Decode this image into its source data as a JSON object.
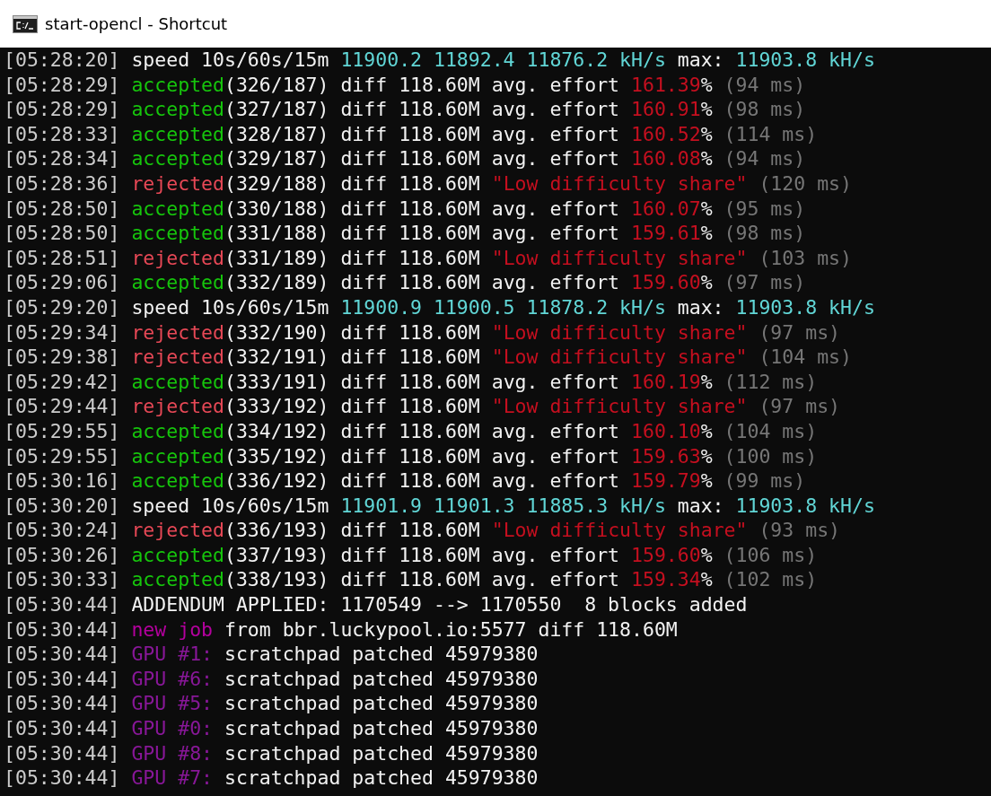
{
  "window": {
    "title": "start-opencl - Shortcut"
  },
  "lines": [
    [
      {
        "kind": "time",
        "text": "[05:28:20]"
      },
      {
        "kind": "text",
        "text": "speed 10s/60s/15m "
      },
      {
        "kind": "rate",
        "text": "11900.2 11892.4 11876.2 kH/s"
      },
      {
        "kind": "text",
        "text": " max: "
      },
      {
        "kind": "rate",
        "text": "11903.8 kH/s"
      }
    ],
    [
      {
        "kind": "time",
        "text": "[05:28:29]"
      },
      {
        "kind": "ok",
        "text": "accepted"
      },
      {
        "kind": "text",
        "text": "(326/187) diff 118.60M avg. effort "
      },
      {
        "kind": "pct",
        "text": "161.39"
      },
      {
        "kind": "text",
        "text": "%"
      },
      {
        "kind": "dim",
        "text": "(94 ms)"
      }
    ],
    [
      {
        "kind": "time",
        "text": "[05:28:29]"
      },
      {
        "kind": "ok",
        "text": "accepted"
      },
      {
        "kind": "text",
        "text": "(327/187) diff 118.60M avg. effort "
      },
      {
        "kind": "pct",
        "text": "160.91"
      },
      {
        "kind": "text",
        "text": "%"
      },
      {
        "kind": "dim",
        "text": "(98 ms)"
      }
    ],
    [
      {
        "kind": "time",
        "text": "[05:28:33]"
      },
      {
        "kind": "ok",
        "text": "accepted"
      },
      {
        "kind": "text",
        "text": "(328/187) diff 118.60M avg. effort "
      },
      {
        "kind": "pct",
        "text": "160.52"
      },
      {
        "kind": "text",
        "text": "%"
      },
      {
        "kind": "dim",
        "text": "(114 ms)"
      }
    ],
    [
      {
        "kind": "time",
        "text": "[05:28:34]"
      },
      {
        "kind": "ok",
        "text": "accepted"
      },
      {
        "kind": "text",
        "text": "(329/187) diff 118.60M avg. effort "
      },
      {
        "kind": "pct",
        "text": "160.08"
      },
      {
        "kind": "text",
        "text": "%"
      },
      {
        "kind": "dim",
        "text": "(94 ms)"
      }
    ],
    [
      {
        "kind": "time",
        "text": "[05:28:36]"
      },
      {
        "kind": "bad",
        "text": "rejected"
      },
      {
        "kind": "text",
        "text": "(329/188) diff 118.60M "
      },
      {
        "kind": "pct",
        "text": "\"Low difficulty share\""
      },
      {
        "kind": "dim",
        "text": "(120 ms)"
      }
    ],
    [
      {
        "kind": "time",
        "text": "[05:28:50]"
      },
      {
        "kind": "ok",
        "text": "accepted"
      },
      {
        "kind": "text",
        "text": "(330/188) diff 118.60M avg. effort "
      },
      {
        "kind": "pct",
        "text": "160.07"
      },
      {
        "kind": "text",
        "text": "%"
      },
      {
        "kind": "dim",
        "text": "(95 ms)"
      }
    ],
    [
      {
        "kind": "time",
        "text": "[05:28:50]"
      },
      {
        "kind": "ok",
        "text": "accepted"
      },
      {
        "kind": "text",
        "text": "(331/188) diff 118.60M avg. effort "
      },
      {
        "kind": "pct",
        "text": "159.61"
      },
      {
        "kind": "text",
        "text": "%"
      },
      {
        "kind": "dim",
        "text": "(98 ms)"
      }
    ],
    [
      {
        "kind": "time",
        "text": "[05:28:51]"
      },
      {
        "kind": "bad",
        "text": "rejected"
      },
      {
        "kind": "text",
        "text": "(331/189) diff 118.60M "
      },
      {
        "kind": "pct",
        "text": "\"Low difficulty share\""
      },
      {
        "kind": "dim",
        "text": "(103 ms)"
      }
    ],
    [
      {
        "kind": "time",
        "text": "[05:29:06]"
      },
      {
        "kind": "ok",
        "text": "accepted"
      },
      {
        "kind": "text",
        "text": "(332/189) diff 118.60M avg. effort "
      },
      {
        "kind": "pct",
        "text": "159.60"
      },
      {
        "kind": "text",
        "text": "%"
      },
      {
        "kind": "dim",
        "text": "(97 ms)"
      }
    ],
    [
      {
        "kind": "time",
        "text": "[05:29:20]"
      },
      {
        "kind": "text",
        "text": "speed 10s/60s/15m "
      },
      {
        "kind": "rate",
        "text": "11900.9 11900.5 11878.2 kH/s"
      },
      {
        "kind": "text",
        "text": " max: "
      },
      {
        "kind": "rate",
        "text": "11903.8 kH/s"
      }
    ],
    [
      {
        "kind": "time",
        "text": "[05:29:34]"
      },
      {
        "kind": "bad",
        "text": "rejected"
      },
      {
        "kind": "text",
        "text": "(332/190) diff 118.60M "
      },
      {
        "kind": "pct",
        "text": "\"Low difficulty share\""
      },
      {
        "kind": "dim",
        "text": "(97 ms)"
      }
    ],
    [
      {
        "kind": "time",
        "text": "[05:29:38]"
      },
      {
        "kind": "bad",
        "text": "rejected"
      },
      {
        "kind": "text",
        "text": "(332/191) diff 118.60M "
      },
      {
        "kind": "pct",
        "text": "\"Low difficulty share\""
      },
      {
        "kind": "dim",
        "text": "(104 ms)"
      }
    ],
    [
      {
        "kind": "time",
        "text": "[05:29:42]"
      },
      {
        "kind": "ok",
        "text": "accepted"
      },
      {
        "kind": "text",
        "text": "(333/191) diff 118.60M avg. effort "
      },
      {
        "kind": "pct",
        "text": "160.19"
      },
      {
        "kind": "text",
        "text": "%"
      },
      {
        "kind": "dim",
        "text": "(112 ms)"
      }
    ],
    [
      {
        "kind": "time",
        "text": "[05:29:44]"
      },
      {
        "kind": "bad",
        "text": "rejected"
      },
      {
        "kind": "text",
        "text": "(333/192) diff 118.60M "
      },
      {
        "kind": "pct",
        "text": "\"Low difficulty share\""
      },
      {
        "kind": "dim",
        "text": "(97 ms)"
      }
    ],
    [
      {
        "kind": "time",
        "text": "[05:29:55]"
      },
      {
        "kind": "ok",
        "text": "accepted"
      },
      {
        "kind": "text",
        "text": "(334/192) diff 118.60M avg. effort "
      },
      {
        "kind": "pct",
        "text": "160.10"
      },
      {
        "kind": "text",
        "text": "%"
      },
      {
        "kind": "dim",
        "text": "(104 ms)"
      }
    ],
    [
      {
        "kind": "time",
        "text": "[05:29:55]"
      },
      {
        "kind": "ok",
        "text": "accepted"
      },
      {
        "kind": "text",
        "text": "(335/192) diff 118.60M avg. effort "
      },
      {
        "kind": "pct",
        "text": "159.63"
      },
      {
        "kind": "text",
        "text": "%"
      },
      {
        "kind": "dim",
        "text": "(100 ms)"
      }
    ],
    [
      {
        "kind": "time",
        "text": "[05:30:16]"
      },
      {
        "kind": "ok",
        "text": "accepted"
      },
      {
        "kind": "text",
        "text": "(336/192) diff 118.60M avg. effort "
      },
      {
        "kind": "pct",
        "text": "159.79"
      },
      {
        "kind": "text",
        "text": "%"
      },
      {
        "kind": "dim",
        "text": "(99 ms)"
      }
    ],
    [
      {
        "kind": "time",
        "text": "[05:30:20]"
      },
      {
        "kind": "text",
        "text": "speed 10s/60s/15m "
      },
      {
        "kind": "rate",
        "text": "11901.9 11901.3 11885.3 kH/s"
      },
      {
        "kind": "text",
        "text": " max: "
      },
      {
        "kind": "rate",
        "text": "11903.8 kH/s"
      }
    ],
    [
      {
        "kind": "time",
        "text": "[05:30:24]"
      },
      {
        "kind": "bad",
        "text": "rejected"
      },
      {
        "kind": "text",
        "text": "(336/193) diff 118.60M "
      },
      {
        "kind": "pct",
        "text": "\"Low difficulty share\""
      },
      {
        "kind": "dim",
        "text": "(93 ms)"
      }
    ],
    [
      {
        "kind": "time",
        "text": "[05:30:26]"
      },
      {
        "kind": "ok",
        "text": "accepted"
      },
      {
        "kind": "text",
        "text": "(337/193) diff 118.60M avg. effort "
      },
      {
        "kind": "pct",
        "text": "159.60"
      },
      {
        "kind": "text",
        "text": "%"
      },
      {
        "kind": "dim",
        "text": "(106 ms)"
      }
    ],
    [
      {
        "kind": "time",
        "text": "[05:30:33]"
      },
      {
        "kind": "ok",
        "text": "accepted"
      },
      {
        "kind": "text",
        "text": "(338/193) diff 118.60M avg. effort "
      },
      {
        "kind": "pct",
        "text": "159.34"
      },
      {
        "kind": "text",
        "text": "%"
      },
      {
        "kind": "dim",
        "text": "(102 ms)"
      }
    ],
    [
      {
        "kind": "time",
        "text": "[05:30:44]"
      },
      {
        "kind": "text",
        "text": "ADDENDUM APPLIED: 1170549 --> 1170550  8 blocks added"
      }
    ],
    [
      {
        "kind": "time",
        "text": "[05:30:44]"
      },
      {
        "kind": "job",
        "text": "new job"
      },
      {
        "kind": "text",
        "text": " from bbr.luckypool.io:5577 diff 118.60M"
      }
    ],
    [
      {
        "kind": "time",
        "text": "[05:30:44]"
      },
      {
        "kind": "gpu",
        "text": "GPU #1:"
      },
      {
        "kind": "text",
        "text": " scratchpad patched 45979380"
      }
    ],
    [
      {
        "kind": "time",
        "text": "[05:30:44]"
      },
      {
        "kind": "gpu",
        "text": "GPU #6:"
      },
      {
        "kind": "text",
        "text": " scratchpad patched 45979380"
      }
    ],
    [
      {
        "kind": "time",
        "text": "[05:30:44]"
      },
      {
        "kind": "gpu",
        "text": "GPU #5:"
      },
      {
        "kind": "text",
        "text": " scratchpad patched 45979380"
      }
    ],
    [
      {
        "kind": "time",
        "text": "[05:30:44]"
      },
      {
        "kind": "gpu",
        "text": "GPU #0:"
      },
      {
        "kind": "text",
        "text": " scratchpad patched 45979380"
      }
    ],
    [
      {
        "kind": "time",
        "text": "[05:30:44]"
      },
      {
        "kind": "gpu",
        "text": "GPU #8:"
      },
      {
        "kind": "text",
        "text": " scratchpad patched 45979380"
      }
    ],
    [
      {
        "kind": "time",
        "text": "[05:30:44]"
      },
      {
        "kind": "gpu",
        "text": "GPU #7:"
      },
      {
        "kind": "text",
        "text": " scratchpad patched 45979380"
      }
    ]
  ]
}
